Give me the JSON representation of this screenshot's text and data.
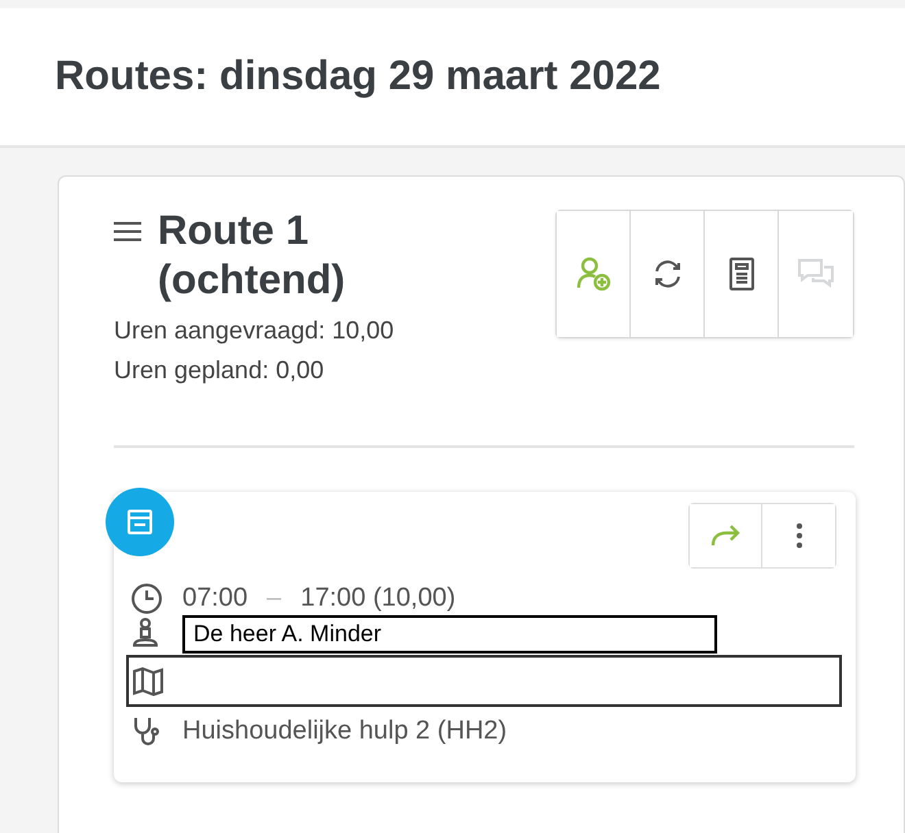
{
  "header": {
    "title": "Routes: dinsdag 29 maart 2022"
  },
  "route": {
    "title": "Route 1 (ochtend)",
    "stats": [
      "Uren aangevraagd: 10,00",
      "Uren gepland: 0,00"
    ],
    "toolbar": [
      {
        "kind": "add-person",
        "disabled": false
      },
      {
        "kind": "refresh",
        "disabled": false
      },
      {
        "kind": "document",
        "disabled": false
      },
      {
        "kind": "chat",
        "disabled": true
      }
    ],
    "appointment": {
      "actions": [
        {
          "kind": "forward"
        },
        {
          "kind": "more"
        }
      ],
      "time_start": "07:00",
      "time_separator": "–",
      "time_end": "17:00 (10,00)",
      "client": "De heer A. Minder",
      "service": "Huishoudelijke hulp 2 (HH2)"
    }
  }
}
